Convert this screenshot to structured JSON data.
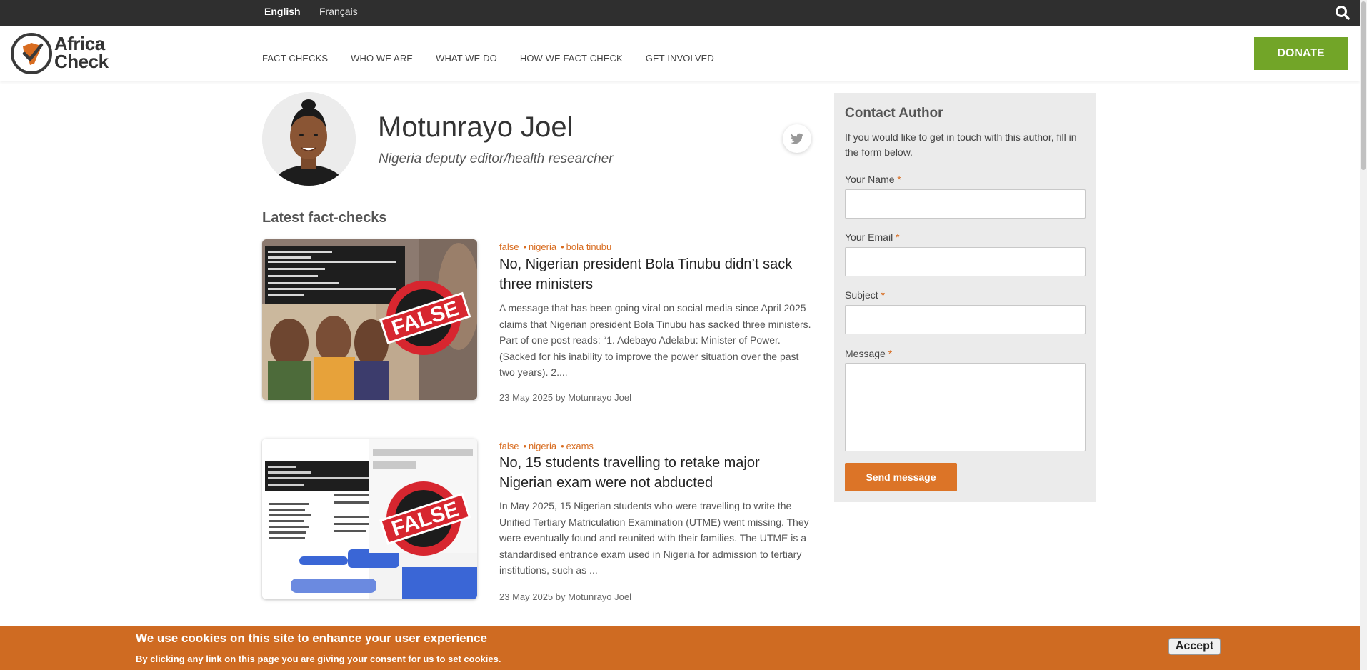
{
  "languages": [
    {
      "label": "English",
      "active": true
    },
    {
      "label": "Français",
      "active": false
    }
  ],
  "logo": {
    "line1": "Africa",
    "line2": "Check"
  },
  "nav": [
    "FACT-CHECKS",
    "WHO WE ARE",
    "WHAT WE DO",
    "HOW WE FACT-CHECK",
    "GET INVOLVED"
  ],
  "donate_label": "DONATE",
  "author": {
    "name": "Motunrayo Joel",
    "role": "Nigeria deputy editor/health researcher"
  },
  "latest_title": "Latest fact-checks",
  "articles": [
    {
      "tags": [
        "false",
        "nigeria",
        "bola tinubu"
      ],
      "title": "No, Nigerian president Bola Tinubu didn’t sack three ministers",
      "excerpt": "A message that has been going viral on social media since April 2025 claims that Nigerian president Bola Tinubu has sacked three ministers. Part of one post reads: “1. Adebayo Adelabu: Minister of Power. (Sacked for his inability to improve the power situation over the past two years). 2....",
      "meta": "23 May 2025 by Motunrayo Joel",
      "stamp": "FALSE"
    },
    {
      "tags": [
        "false",
        "nigeria",
        "exams"
      ],
      "title": "No, 15 students travelling to retake major Nigerian exam were not abducted",
      "excerpt": "In May 2025, 15 Nigerian students who were travelling to write the Unified Tertiary Matriculation Examination (UTME) went missing. They were eventually found and reunited with their families. The UTME is a standardised entrance exam used in Nigeria for admission to tertiary institutions, such as ...",
      "meta": "23 May 2025 by Motunrayo Joel",
      "stamp": "FALSE"
    }
  ],
  "contact": {
    "title": "Contact Author",
    "intro": "If you would like to get in touch with this author, fill in the form below.",
    "fields": {
      "name": "Your Name",
      "email": "Your Email",
      "subject": "Subject",
      "message": "Message"
    },
    "required_mark": "*",
    "send_label": "Send message"
  },
  "cookie": {
    "title": "We use cookies on this site to enhance your user experience",
    "subtitle": "By clicking any link on this page you are giving your consent for us to set cookies.",
    "accept_label": "Accept"
  },
  "colors": {
    "topbar": "#2f2f2f",
    "donate": "#72a528",
    "accent": "#d86c20",
    "cookie_bar": "#cf6b22"
  }
}
